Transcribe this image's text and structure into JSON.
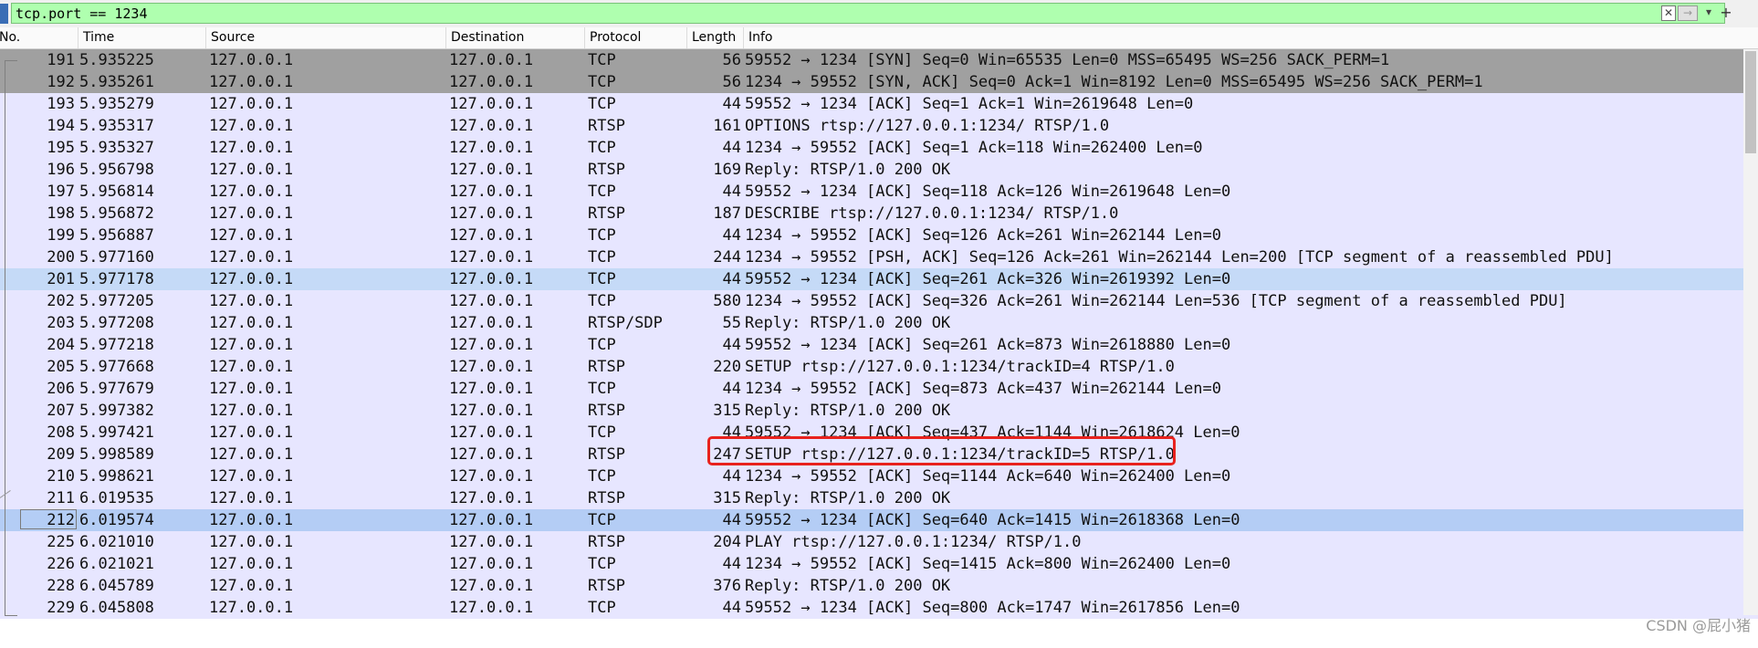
{
  "filter": {
    "value": "tcp.port == 1234",
    "clear_icon": "✕",
    "apply_icon": "→",
    "dropdown_icon": "▾",
    "add_icon": "+"
  },
  "columns": [
    "No.",
    "Time",
    "Source",
    "Destination",
    "Protocol",
    "Length",
    "Info"
  ],
  "packets": [
    {
      "no": "191",
      "time": "5.935225",
      "src": "127.0.0.1",
      "dst": "127.0.0.1",
      "proto": "TCP",
      "len": "56",
      "info": "59552 → 1234 [SYN] Seq=0 Win=65535 Len=0 MSS=65495 WS=256 SACK_PERM=1",
      "style": "handshake"
    },
    {
      "no": "192",
      "time": "5.935261",
      "src": "127.0.0.1",
      "dst": "127.0.0.1",
      "proto": "TCP",
      "len": "56",
      "info": "1234 → 59552 [SYN, ACK] Seq=0 Ack=1 Win=8192 Len=0 MSS=65495 WS=256 SACK_PERM=1",
      "style": "handshake"
    },
    {
      "no": "193",
      "time": "5.935279",
      "src": "127.0.0.1",
      "dst": "127.0.0.1",
      "proto": "TCP",
      "len": "44",
      "info": "59552 → 1234 [ACK] Seq=1 Ack=1 Win=2619648 Len=0",
      "style": ""
    },
    {
      "no": "194",
      "time": "5.935317",
      "src": "127.0.0.1",
      "dst": "127.0.0.1",
      "proto": "RTSP",
      "len": "161",
      "info": "OPTIONS rtsp://127.0.0.1:1234/ RTSP/1.0",
      "style": ""
    },
    {
      "no": "195",
      "time": "5.935327",
      "src": "127.0.0.1",
      "dst": "127.0.0.1",
      "proto": "TCP",
      "len": "44",
      "info": "1234 → 59552 [ACK] Seq=1 Ack=118 Win=262400 Len=0",
      "style": ""
    },
    {
      "no": "196",
      "time": "5.956798",
      "src": "127.0.0.1",
      "dst": "127.0.0.1",
      "proto": "RTSP",
      "len": "169",
      "info": "Reply: RTSP/1.0 200 OK",
      "style": ""
    },
    {
      "no": "197",
      "time": "5.956814",
      "src": "127.0.0.1",
      "dst": "127.0.0.1",
      "proto": "TCP",
      "len": "44",
      "info": "59552 → 1234 [ACK] Seq=118 Ack=126 Win=2619648 Len=0",
      "style": ""
    },
    {
      "no": "198",
      "time": "5.956872",
      "src": "127.0.0.1",
      "dst": "127.0.0.1",
      "proto": "RTSP",
      "len": "187",
      "info": "DESCRIBE rtsp://127.0.0.1:1234/ RTSP/1.0",
      "style": ""
    },
    {
      "no": "199",
      "time": "5.956887",
      "src": "127.0.0.1",
      "dst": "127.0.0.1",
      "proto": "TCP",
      "len": "44",
      "info": "1234 → 59552 [ACK] Seq=126 Ack=261 Win=262144 Len=0",
      "style": ""
    },
    {
      "no": "200",
      "time": "5.977160",
      "src": "127.0.0.1",
      "dst": "127.0.0.1",
      "proto": "TCP",
      "len": "244",
      "info": "1234 → 59552 [PSH, ACK] Seq=126 Ack=261 Win=262144 Len=200 [TCP segment of a reassembled PDU]",
      "style": ""
    },
    {
      "no": "201",
      "time": "5.977178",
      "src": "127.0.0.1",
      "dst": "127.0.0.1",
      "proto": "TCP",
      "len": "44",
      "info": "59552 → 1234 [ACK] Seq=261 Ack=326 Win=2619392 Len=0",
      "style": "selected"
    },
    {
      "no": "202",
      "time": "5.977205",
      "src": "127.0.0.1",
      "dst": "127.0.0.1",
      "proto": "TCP",
      "len": "580",
      "info": "1234 → 59552 [ACK] Seq=326 Ack=261 Win=262144 Len=536 [TCP segment of a reassembled PDU]",
      "style": ""
    },
    {
      "no": "203",
      "time": "5.977208",
      "src": "127.0.0.1",
      "dst": "127.0.0.1",
      "proto": "RTSP/SDP",
      "len": "55",
      "info": "Reply: RTSP/1.0 200 OK",
      "style": ""
    },
    {
      "no": "204",
      "time": "5.977218",
      "src": "127.0.0.1",
      "dst": "127.0.0.1",
      "proto": "TCP",
      "len": "44",
      "info": "59552 → 1234 [ACK] Seq=261 Ack=873 Win=2618880 Len=0",
      "style": ""
    },
    {
      "no": "205",
      "time": "5.977668",
      "src": "127.0.0.1",
      "dst": "127.0.0.1",
      "proto": "RTSP",
      "len": "220",
      "info": "SETUP rtsp://127.0.0.1:1234/trackID=4 RTSP/1.0",
      "style": ""
    },
    {
      "no": "206",
      "time": "5.977679",
      "src": "127.0.0.1",
      "dst": "127.0.0.1",
      "proto": "TCP",
      "len": "44",
      "info": "1234 → 59552 [ACK] Seq=873 Ack=437 Win=262144 Len=0",
      "style": ""
    },
    {
      "no": "207",
      "time": "5.997382",
      "src": "127.0.0.1",
      "dst": "127.0.0.1",
      "proto": "RTSP",
      "len": "315",
      "info": "Reply: RTSP/1.0 200 OK",
      "style": ""
    },
    {
      "no": "208",
      "time": "5.997421",
      "src": "127.0.0.1",
      "dst": "127.0.0.1",
      "proto": "TCP",
      "len": "44",
      "info": "59552 → 1234 [ACK] Seq=437 Ack=1144 Win=2618624 Len=0",
      "style": ""
    },
    {
      "no": "209",
      "time": "5.998589",
      "src": "127.0.0.1",
      "dst": "127.0.0.1",
      "proto": "RTSP",
      "len": "247",
      "info": "SETUP rtsp://127.0.0.1:1234/trackID=5 RTSP/1.0",
      "style": ""
    },
    {
      "no": "210",
      "time": "5.998621",
      "src": "127.0.0.1",
      "dst": "127.0.0.1",
      "proto": "TCP",
      "len": "44",
      "info": "1234 → 59552 [ACK] Seq=1144 Ack=640 Win=262400 Len=0",
      "style": ""
    },
    {
      "no": "211",
      "time": "6.019535",
      "src": "127.0.0.1",
      "dst": "127.0.0.1",
      "proto": "RTSP",
      "len": "315",
      "info": "Reply: RTSP/1.0 200 OK",
      "style": ""
    },
    {
      "no": "212",
      "time": "6.019574",
      "src": "127.0.0.1",
      "dst": "127.0.0.1",
      "proto": "TCP",
      "len": "44",
      "info": "59552 → 1234 [ACK] Seq=640 Ack=1415 Win=2618368 Len=0",
      "style": "focused"
    },
    {
      "no": "225",
      "time": "6.021010",
      "src": "127.0.0.1",
      "dst": "127.0.0.1",
      "proto": "RTSP",
      "len": "204",
      "info": "PLAY rtsp://127.0.0.1:1234/ RTSP/1.0",
      "style": ""
    },
    {
      "no": "226",
      "time": "6.021021",
      "src": "127.0.0.1",
      "dst": "127.0.0.1",
      "proto": "TCP",
      "len": "44",
      "info": "1234 → 59552 [ACK] Seq=1415 Ack=800 Win=262400 Len=0",
      "style": ""
    },
    {
      "no": "228",
      "time": "6.045789",
      "src": "127.0.0.1",
      "dst": "127.0.0.1",
      "proto": "RTSP",
      "len": "376",
      "info": "Reply: RTSP/1.0 200 OK",
      "style": ""
    },
    {
      "no": "229",
      "time": "6.045808",
      "src": "127.0.0.1",
      "dst": "127.0.0.1",
      "proto": "TCP",
      "len": "44",
      "info": "59552 → 1234 [ACK] Seq=800 Ack=1747 Win=2617856 Len=0",
      "style": ""
    }
  ],
  "watermark": "CSDN @屁小猪",
  "colors": {
    "filter_valid": "#afffaf",
    "row_tcp": "#e7e6ff",
    "row_handshake": "#a0a0a0",
    "row_selected": "#c5daf7",
    "highlight": "#e8221d"
  }
}
